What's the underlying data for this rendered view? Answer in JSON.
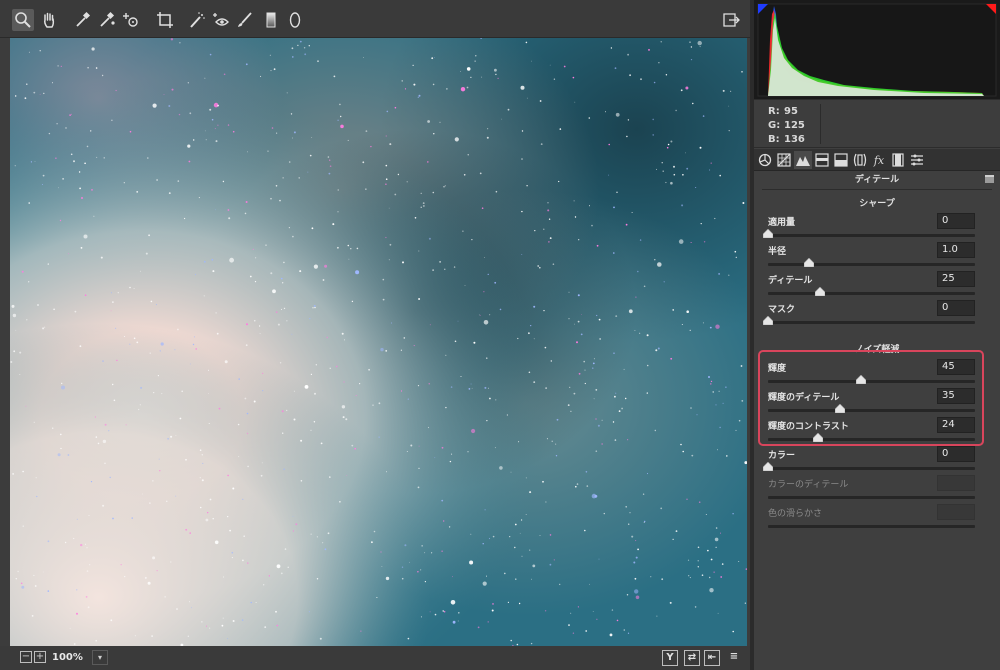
{
  "toolbar": {
    "tools": [
      "zoom-tool",
      "hand-tool",
      "white-balance-tool",
      "color-sampler-tool",
      "target-adjustment-tool",
      "crop-tool",
      "spot-removal-tool",
      "red-eye-tool",
      "adjustment-brush-tool",
      "graduated-filter-tool",
      "radial-filter-tool"
    ],
    "open_preferences": "toggle-fullscreen"
  },
  "readout": {
    "r_label": "R:",
    "r_value": "95",
    "g_label": "G:",
    "g_value": "125",
    "b_label": "B:",
    "b_value": "136"
  },
  "panel": {
    "title": "ディテール",
    "sharpen": {
      "title": "シャープ",
      "sliders": [
        {
          "label": "適用量",
          "value": "0",
          "fraction": 0.0
        },
        {
          "label": "半径",
          "value": "1.0",
          "fraction": 0.2
        },
        {
          "label": "ディテール",
          "value": "25",
          "fraction": 0.25
        },
        {
          "label": "マスク",
          "value": "0",
          "fraction": 0.0
        }
      ]
    },
    "noise": {
      "title": "ノイズ軽減",
      "sliders": [
        {
          "label": "輝度",
          "value": "45",
          "fraction": 0.45
        },
        {
          "label": "輝度のディテール",
          "value": "35",
          "fraction": 0.35
        },
        {
          "label": "輝度のコントラスト",
          "value": "24",
          "fraction": 0.24
        },
        {
          "label": "カラー",
          "value": "0",
          "fraction": 0.0
        },
        {
          "label": "カラーのディテール",
          "value": "",
          "fraction": null,
          "disabled": true
        },
        {
          "label": "色の滑らかさ",
          "value": "",
          "fraction": null,
          "disabled": true
        }
      ]
    }
  },
  "bottombar": {
    "zoom_out": "−",
    "zoom_in": "+",
    "zoom_level": "100%",
    "view_buttons": [
      "Y",
      "⇄",
      "⇤",
      "≡"
    ]
  },
  "colors": {
    "highlight": "#d9455c",
    "histogram_red": "#ff2a2a",
    "histogram_green": "#2ee82e",
    "histogram_blue": "#2a6bff",
    "clip_shadow": "#1f3cff",
    "clip_highlight": "#ff1a1a"
  }
}
